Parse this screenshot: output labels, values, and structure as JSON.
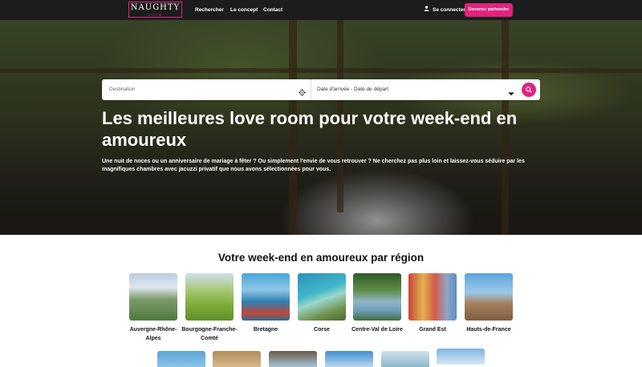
{
  "header": {
    "logo_main": "NAUGHTY",
    "logo_sub": "ROOM",
    "nav": [
      "Rechercher",
      "Le concept",
      "Contact"
    ],
    "login_label": "Se connecter",
    "cta_label": "Devenez partenaire",
    "user_icon": "user-icon"
  },
  "search": {
    "destination_placeholder": "Destination",
    "dates_label": "Date d'arrivée - Date de départ",
    "icons": [
      "crosshair-icon",
      "chevron-down-icon",
      "search-icon"
    ]
  },
  "hero": {
    "title": "Les meilleures love room pour votre week-end en amoureux",
    "subtitle": "Une nuit de noces ou un anniversaire de mariage à fêter ? Ou simplement l'envie de vous retrouver ? Ne cherchez pas plus loin et laissez-vous séduire par les magnifiques chambres avec jacuzzi privatif que nous avons sélectionnées pour vous."
  },
  "regions": {
    "title": "Votre week-end en amoureux par région",
    "items": [
      {
        "name": "Auvergne-Rhône-Alpes"
      },
      {
        "name": "Bourgogne-Franche-Comté"
      },
      {
        "name": "Bretagne"
      },
      {
        "name": "Corse"
      },
      {
        "name": "Centre-Val de Loire"
      },
      {
        "name": "Grand Est"
      },
      {
        "name": "Hauts-de-France"
      }
    ]
  },
  "colors": {
    "accent": "#e0247d",
    "header_bg": "#1c1c1c"
  }
}
